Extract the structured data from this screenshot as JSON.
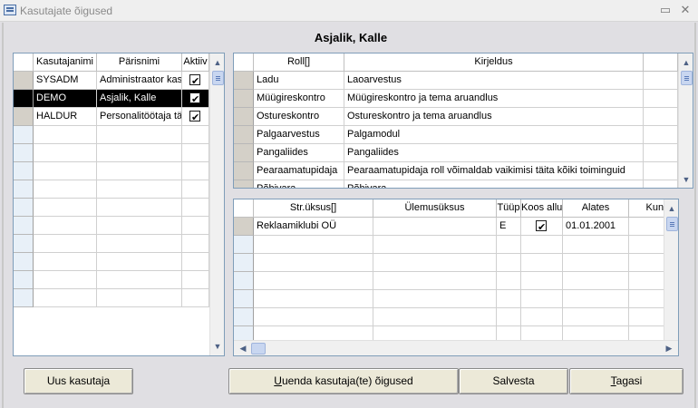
{
  "window": {
    "title": "Kasutajate õigused",
    "minimize_icon": "▭",
    "close_icon": "✕"
  },
  "heading": "Asjalik, Kalle",
  "users": {
    "columns": [
      "Kasutajanimi",
      "Pärisnimi",
      "Aktiiv"
    ],
    "rows": [
      {
        "username": "SYSADM",
        "fullname": "Administraator kas",
        "active": true,
        "selected": false
      },
      {
        "username": "DEMO",
        "fullname": "Asjalik, Kalle",
        "active": true,
        "selected": true
      },
      {
        "username": "HALDUR",
        "fullname": "Personalitöötaja tä",
        "active": true,
        "selected": false
      }
    ],
    "empty_rows": 10
  },
  "roles": {
    "columns": [
      "Roll[]",
      "Kirjeldus"
    ],
    "rows": [
      {
        "role": "Ladu",
        "description": "Laoarvestus"
      },
      {
        "role": "Müügireskontro",
        "description": "Müügireskontro ja tema aruandlus"
      },
      {
        "role": "Ostureskontro",
        "description": "Ostureskontro ja tema aruandlus"
      },
      {
        "role": "Palgaarvestus",
        "description": "Palgamodul"
      },
      {
        "role": "Pangaliides",
        "description": "Pangaliides"
      },
      {
        "role": "Pearaamatupidaja",
        "description": "Pearaamatupidaja roll võimaldab vaikimisi täita kõiki toiminguid"
      },
      {
        "role": "Põhivara",
        "description": "Põhivara"
      }
    ]
  },
  "units": {
    "columns": [
      "Str.üksus[]",
      "Ülemusüksus",
      "Tüüp",
      "Koos allu",
      "Alates",
      "Kuni"
    ],
    "rows": [
      {
        "unit": "Reklaamiklubi OÜ",
        "parent": "",
        "type": "E",
        "with_sub": true,
        "from": "01.01.2001",
        "to": ""
      }
    ],
    "empty_rows": 6
  },
  "buttons": {
    "new_user": "Uus kasutaja",
    "update_rights_prefix": "U",
    "update_rights_rest": "uenda kasutaja(te) õigused",
    "save": "Salvesta",
    "back_prefix": "T",
    "back_rest": "agasi"
  },
  "icons": {
    "scroll_up": "▲",
    "scroll_down": "▼",
    "scroll_left": "◀",
    "scroll_right": "▶"
  }
}
